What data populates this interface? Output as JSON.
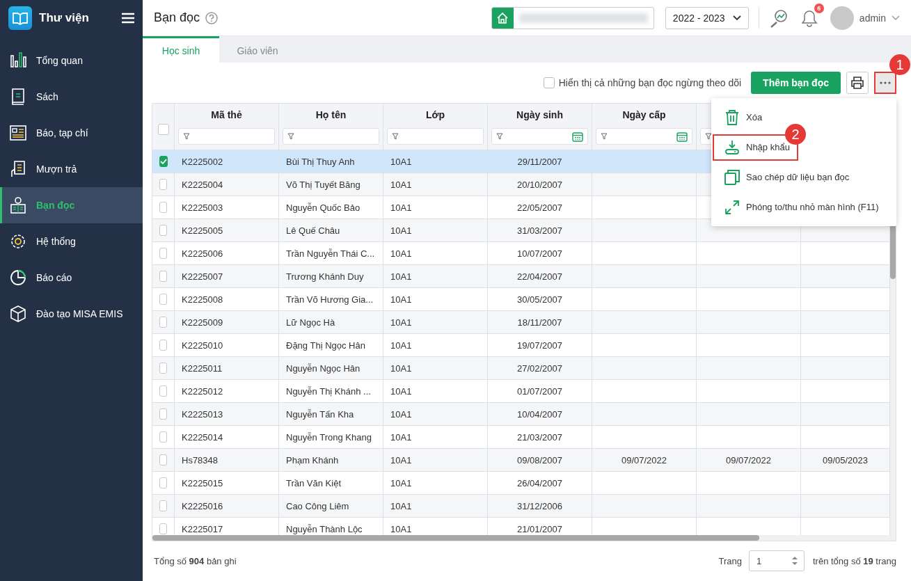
{
  "sidebar": {
    "title": "Thư viện",
    "items": [
      {
        "label": "Tổng quan",
        "selected": false
      },
      {
        "label": "Sách",
        "selected": false
      },
      {
        "label": "Báo, tạp chí",
        "selected": false
      },
      {
        "label": "Mượn trả",
        "selected": false
      },
      {
        "label": "Bạn đọc",
        "selected": true
      },
      {
        "label": "Hệ thống",
        "selected": false
      },
      {
        "label": "Báo cáo",
        "selected": false
      },
      {
        "label": "Đào tạo MISA EMIS",
        "selected": false
      }
    ]
  },
  "header": {
    "title": "Bạn đọc",
    "year": "2022 - 2023",
    "notification_count": "6",
    "user": "admin"
  },
  "tabs": [
    {
      "label": "Học sinh",
      "selected": true
    },
    {
      "label": "Giáo viên",
      "selected": false
    }
  ],
  "toolbar": {
    "show_inactive": {
      "label": "Hiển thị cả những bạn đọc ngừng theo dõi",
      "checked": false
    },
    "add_button": "Thêm bạn đọc",
    "more_callout": "1"
  },
  "more_menu": [
    {
      "label": "Xóa",
      "highlighted": false
    },
    {
      "label": "Nhập khẩu",
      "highlighted": true,
      "callout": "2"
    },
    {
      "label": "Sao chép dữ liệu bạn đọc",
      "highlighted": false
    },
    {
      "label": "Phóng to/thu nhỏ màn hình (F11)",
      "highlighted": false
    }
  ],
  "table": {
    "select_all_checked": false,
    "columns": [
      {
        "label": "Mã thẻ",
        "kind": "text"
      },
      {
        "label": "Họ tên",
        "kind": "text"
      },
      {
        "label": "Lớp",
        "kind": "text"
      },
      {
        "label": "Ngày sinh",
        "kind": "date"
      },
      {
        "label": "Ngày cấp",
        "kind": "date"
      },
      {
        "kind": "date"
      },
      {
        "kind": "date"
      }
    ],
    "rows": [
      {
        "selected": true,
        "cells": [
          "K2225002",
          "Bùi Thị Thuy Anh",
          "10A1",
          "29/11/2007"
        ]
      },
      {
        "selected": false,
        "cells": [
          "K2225004",
          "Võ Thị Tuyết Băng",
          "10A1",
          "20/10/2007"
        ]
      },
      {
        "selected": false,
        "cells": [
          "K2225003",
          "Nguyễn Quốc Bảo",
          "10A1",
          "22/05/2007"
        ]
      },
      {
        "selected": false,
        "cells": [
          "K2225005",
          "Lê Quế Châu",
          "10A1",
          "31/03/2007"
        ]
      },
      {
        "selected": false,
        "cells": [
          "K2225006",
          "Trần Nguyễn Thái C...",
          "10A1",
          "10/07/2007"
        ]
      },
      {
        "selected": false,
        "cells": [
          "K2225007",
          "Trương Khánh Duy",
          "10A1",
          "22/04/2007"
        ]
      },
      {
        "selected": false,
        "cells": [
          "K2225008",
          "Trần Võ Hương Gia...",
          "10A1",
          "30/05/2007"
        ]
      },
      {
        "selected": false,
        "cells": [
          "K2225009",
          "Lữ Ngọc Hà",
          "10A1",
          "18/11/2007"
        ]
      },
      {
        "selected": false,
        "cells": [
          "K2225010",
          "Đặng Thị Ngọc Hân",
          "10A1",
          "19/07/2007"
        ]
      },
      {
        "selected": false,
        "cells": [
          "K2225011",
          "Nguyễn Ngọc Hân",
          "10A1",
          "27/02/2007"
        ]
      },
      {
        "selected": false,
        "cells": [
          "K2225012",
          "Nguyễn Thị Khánh ...",
          "10A1",
          "01/07/2007"
        ]
      },
      {
        "selected": false,
        "cells": [
          "K2225013",
          "Nguyễn Tấn Kha",
          "10A1",
          "10/04/2007"
        ]
      },
      {
        "selected": false,
        "cells": [
          "K2225014",
          "Nguyễn Trong Khang",
          "10A1",
          "21/03/2007"
        ]
      },
      {
        "selected": false,
        "cells": [
          "Hs78348",
          "Phạm Khánh",
          "10A1",
          "09/08/2007",
          "09/07/2022",
          "09/07/2022",
          "09/05/2023"
        ]
      },
      {
        "selected": false,
        "cells": [
          "K2225015",
          "Trần Văn Kiệt",
          "10A1",
          "26/04/2007"
        ]
      },
      {
        "selected": false,
        "cells": [
          "K2225016",
          "Cao Công Liêm",
          "10A1",
          "31/12/2006"
        ]
      },
      {
        "selected": false,
        "cells": [
          "K2225017",
          "Nguyễn Thành Lộc",
          "10A1",
          "21/01/2007"
        ]
      }
    ]
  },
  "footer": {
    "total": "Tổng số **904** bản ghi",
    "page_label": "Trang",
    "page": "1",
    "page_total": "trên tổng số **19** trang"
  }
}
